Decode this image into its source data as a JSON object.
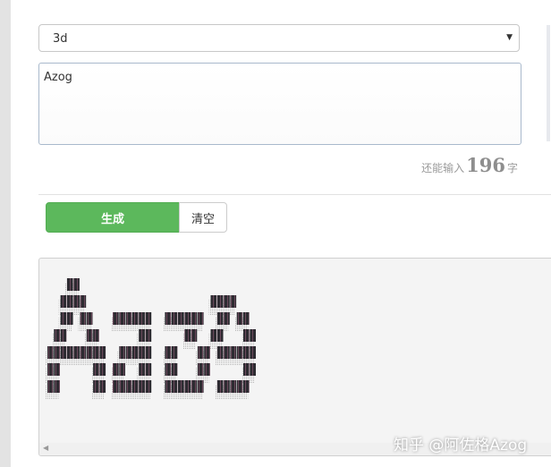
{
  "style_select": {
    "value": "3d"
  },
  "input_text": {
    "value": "Azog"
  },
  "counter": {
    "prefix": "还能输入",
    "remaining": "196",
    "suffix": "字"
  },
  "buttons": {
    "generate": "生成",
    "clear": "清空"
  },
  "watermark": {
    "text": "知乎 @阿佐格Azog"
  },
  "colors": {
    "primary_green": "#5cb85c",
    "ascii_block": "#2b2b30",
    "ascii_shadow": "#bdbdbd"
  }
}
